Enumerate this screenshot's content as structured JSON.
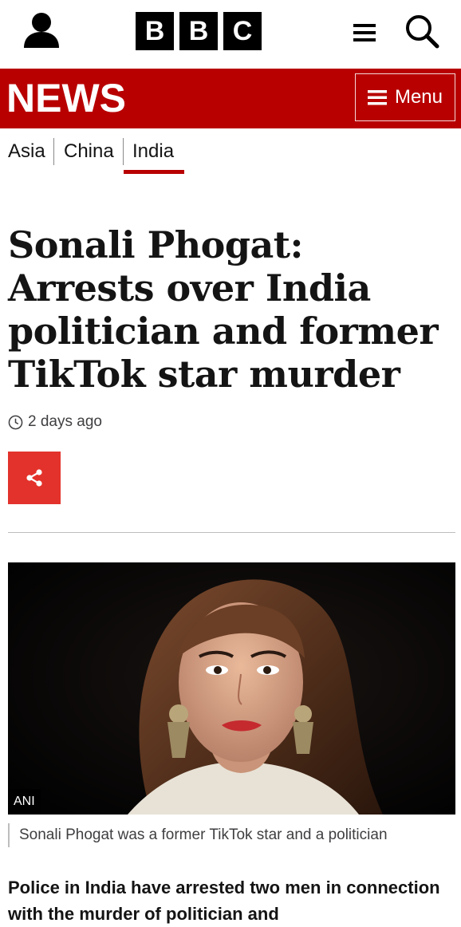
{
  "header": {
    "brand_letters": [
      "B",
      "B",
      "C"
    ],
    "account_icon": "user-icon",
    "more_icon": "hamburger-icon",
    "search_icon": "search-icon"
  },
  "news_bar": {
    "title": "NEWS",
    "menu_label": "Menu",
    "color": "#b80000"
  },
  "subnav": {
    "items": [
      {
        "label": "Asia"
      },
      {
        "label": "China"
      },
      {
        "label": "India",
        "active": true
      }
    ]
  },
  "article": {
    "headline": "Sonali Phogat: Arrests over India politician and former TikTok star murder",
    "timestamp": "2 days ago",
    "share_color": "#e3322b",
    "image": {
      "credit": "ANI",
      "caption": "Sonali Phogat was a former TikTok star and a politician"
    },
    "intro": "Police in India have arrested two men in connection with the murder of politician and"
  }
}
